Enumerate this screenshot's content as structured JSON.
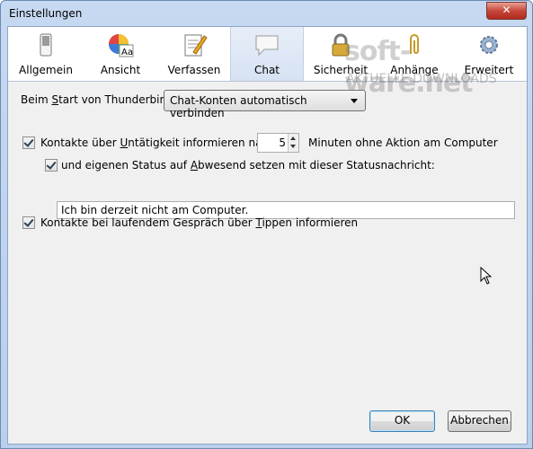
{
  "window": {
    "title": "Einstellungen",
    "close_label": "✕"
  },
  "toolbar": {
    "tabs": [
      {
        "label": "Allgemein",
        "icon": "switch-icon"
      },
      {
        "label": "Ansicht",
        "icon": "color-wheel-icon"
      },
      {
        "label": "Verfassen",
        "icon": "compose-icon"
      },
      {
        "label": "Chat",
        "icon": "chat-bubble-icon",
        "selected": true
      },
      {
        "label": "Sicherheit",
        "icon": "padlock-icon"
      },
      {
        "label": "Anhänge",
        "icon": "paperclip-icon"
      },
      {
        "label": "Erweitert",
        "icon": "gear-icon"
      }
    ]
  },
  "watermark": {
    "brand": "soft-ware.net",
    "tagline": "AKTUELLE DOWNLOADS"
  },
  "chat": {
    "startup_label_pre": "Beim ",
    "startup_label_underlined": "S",
    "startup_label_post": "tart von Thunderbird:",
    "startup_select_value": "Chat-Konten automatisch verbinden",
    "idle_label_pre": "Kontakte über ",
    "idle_label_underlined": "U",
    "idle_label_post": "ntätigkeit informieren nach",
    "idle_minutes": "5",
    "idle_suffix": "Minuten ohne Aktion am Computer",
    "away_label_pre": "und eigenen Status auf ",
    "away_label_underlined": "A",
    "away_label_post": "bwesend setzen mit dieser Statusnachricht:",
    "away_message": "Ich bin derzeit nicht am Computer.",
    "typing_label_pre": "Kontakte bei laufendem Gespräch über ",
    "typing_label_underlined": "T",
    "typing_label_post": "ippen informieren"
  },
  "buttons": {
    "ok": "OK",
    "cancel": "Abbrechen"
  }
}
